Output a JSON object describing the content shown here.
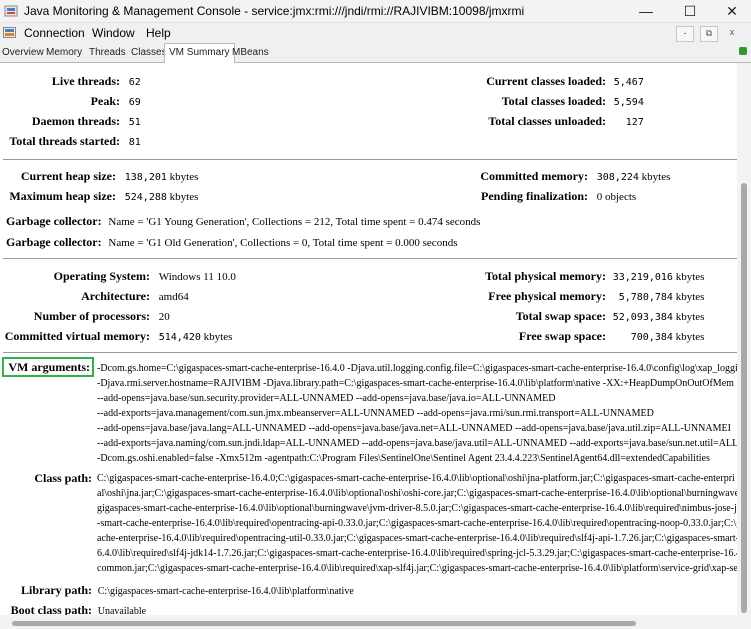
{
  "window": {
    "title": "Java Monitoring & Management Console - service:jmx:rmi:///jndi/rmi://RAJIVIBM:10098/jmxrmi",
    "minimize": "—",
    "maximize": "☐",
    "close": "✕"
  },
  "menu": {
    "items": [
      "Connection",
      "Window",
      "Help"
    ],
    "mdi_buttons": [
      "-",
      "⧉",
      "x"
    ]
  },
  "tabs": [
    "Overview",
    "Memory",
    "Threads",
    "Classes",
    "VM Summary",
    "MBeans"
  ],
  "active_tab": "VM Summary",
  "threads": {
    "live_label": "Live threads:",
    "live_value": "62",
    "peak_label": "Peak:",
    "peak_value": "69",
    "daemon_label": "Daemon threads:",
    "daemon_value": "51",
    "started_label": "Total threads started:",
    "started_value": "81"
  },
  "classes": {
    "loaded_label": "Current classes loaded:",
    "loaded_value": "5,467",
    "total_label": "Total classes loaded:",
    "total_value": "5,594",
    "unloaded_label": "Total classes unloaded:",
    "unloaded_value": "127"
  },
  "memory": {
    "heap_label": "Current heap size:",
    "heap_value": "138,201",
    "heap_unit": "kbytes",
    "max_heap_label": "Maximum heap size:",
    "max_heap_value": "524,288",
    "max_heap_unit": "kbytes",
    "committed_label": "Committed memory:",
    "committed_value": "308,224",
    "committed_unit": "kbytes",
    "pending_label": "Pending finalization:",
    "pending_value": "0 objects"
  },
  "gc": [
    {
      "label": "Garbage collector:",
      "value": "Name = 'G1 Young Generation', Collections = 212, Total time spent = 0.474 seconds"
    },
    {
      "label": "Garbage collector:",
      "value": "Name = 'G1 Old Generation', Collections = 0, Total time spent = 0.000 seconds"
    }
  ],
  "os": {
    "os_label": "Operating System:",
    "os_value": "Windows 11 10.0",
    "arch_label": "Architecture:",
    "arch_value": "amd64",
    "procs_label": "Number of processors:",
    "procs_value": "20",
    "cvm_label": "Committed virtual memory:",
    "cvm_value": "514,420",
    "cvm_unit": "kbytes",
    "tpm_label": "Total physical memory:",
    "tpm_value": "33,219,016",
    "tpm_unit": "kbytes",
    "fpm_label": "Free physical memory:",
    "fpm_value": "5,780,784",
    "fpm_unit": "kbytes",
    "tss_label": "Total swap space:",
    "tss_value": "52,093,384",
    "tss_unit": "kbytes",
    "fss_label": "Free swap space:",
    "fss_value": "700,384",
    "fss_unit": "kbytes"
  },
  "vm_args": {
    "label": "VM arguments:",
    "lines": [
      "-Dcom.gs.home=C:\\gigaspaces-smart-cache-enterprise-16.4.0 -Djava.util.logging.config.file=C:\\gigaspaces-smart-cache-enterprise-16.4.0\\config\\log\\xap_loggi",
      "-Djava.rmi.server.hostname=RAJIVIBM -Djava.library.path=C:\\gigaspaces-smart-cache-enterprise-16.4.0\\lib\\platform\\native -XX:+HeapDumpOnOutOfMem",
      "--add-opens=java.base/sun.security.provider=ALL-UNNAMED --add-opens=java.base/java.io=ALL-UNNAMED",
      "--add-exports=java.management/com.sun.jmx.mbeanserver=ALL-UNNAMED --add-opens=java.rmi/sun.rmi.transport=ALL-UNNAMED",
      "--add-opens=java.base/java.lang=ALL-UNNAMED --add-opens=java.base/java.net=ALL-UNNAMED --add-opens=java.base/java.util.zip=ALL-UNNAMEI",
      "--add-exports=java.naming/com.sun.jndi.ldap=ALL-UNNAMED --add-opens=java.base/java.util=ALL-UNNAMED --add-exports=java.base/sun.net.util=ALL",
      "-Dcom.gs.oshi.enabled=false -Xmx512m -agentpath:C:\\Program Files\\SentinelOne\\Sentinel Agent 23.4.4.223\\SentinelAgent64.dll=extendedCapabilities"
    ]
  },
  "class_path": {
    "label": "Class path:",
    "lines": [
      "C:\\gigaspaces-smart-cache-enterprise-16.4.0;C:\\gigaspaces-smart-cache-enterprise-16.4.0\\lib\\optional\\oshi\\jna-platform.jar;C:\\gigaspaces-smart-cache-enterpri",
      "al\\oshi\\jna.jar;C:\\gigaspaces-smart-cache-enterprise-16.4.0\\lib\\optional\\oshi\\oshi-core.jar;C:\\gigaspaces-smart-cache-enterprise-16.4.0\\lib\\optional\\burningwave\\",
      "gigaspaces-smart-cache-enterprise-16.4.0\\lib\\optional\\burningwave\\jvm-driver-8.5.0.jar;C:\\gigaspaces-smart-cache-enterprise-16.4.0\\lib\\required\\nimbus-jose-jw",
      "-smart-cache-enterprise-16.4.0\\lib\\required\\opentracing-api-0.33.0.jar;C:\\gigaspaces-smart-cache-enterprise-16.4.0\\lib\\required\\opentracing-noop-0.33.0.jar;C:\\g",
      "ache-enterprise-16.4.0\\lib\\required\\opentracing-util-0.33.0.jar;C:\\gigaspaces-smart-cache-enterprise-16.4.0\\lib\\required\\slf4j-api-1.7.26.jar;C:\\gigaspaces-smart-c",
      "6.4.0\\lib\\required\\slf4j-jdk14-1.7.26.jar;C:\\gigaspaces-smart-cache-enterprise-16.4.0\\lib\\required\\spring-jcl-5.3.29.jar;C:\\gigaspaces-smart-cache-enterprise-16.4",
      "common.jar;C:\\gigaspaces-smart-cache-enterprise-16.4.0\\lib\\required\\xap-slf4j.jar;C:\\gigaspaces-smart-cache-enterprise-16.4.0\\lib\\platform\\service-grid\\xap-ser"
    ]
  },
  "library_path": {
    "label": "Library path:",
    "value": "C:\\gigaspaces-smart-cache-enterprise-16.4.0\\lib\\platform\\native"
  },
  "boot_class_path": {
    "label": "Boot class path:",
    "value": "Unavailable"
  },
  "colors": {
    "highlight_box": "#2db34a",
    "separator": "#9a9a9a"
  }
}
